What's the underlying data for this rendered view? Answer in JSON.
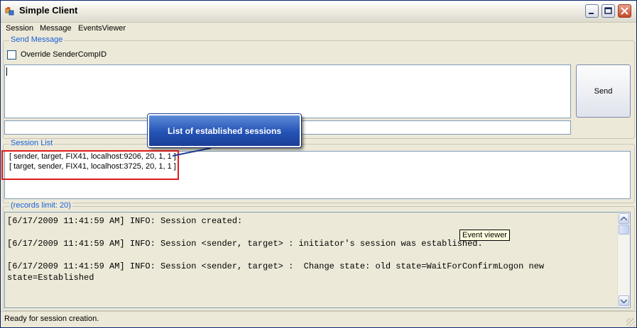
{
  "window": {
    "title": "Simple Client"
  },
  "menu": {
    "items": [
      "Session",
      "Message",
      "EventsViewer"
    ]
  },
  "send_message": {
    "legend": "Send Message",
    "override_label": "Override SenderCompID",
    "override_checked": false,
    "message_value": "",
    "sender_value": "",
    "send_label": "Send"
  },
  "session_list": {
    "legend": "Session List",
    "rows": [
      "[ sender, target, FIX41, localhost:9206, 20, 1, 1 ]",
      "[ target, sender, FIX41, localhost:3725, 20, 1, 1 ]"
    ]
  },
  "annotation": {
    "callout_text": "List of established sessions"
  },
  "events": {
    "legend": "(records limit: 20)",
    "lines": [
      "[6/17/2009 11:41:59 AM] INFO: Session created:",
      "",
      "[6/17/2009 11:41:59 AM] INFO: Session <sender, target> : initiator's session was established.",
      "",
      "[6/17/2009 11:41:59 AM] INFO: Session <sender, target> :  Change state: old state=WaitForConfirmLogon new",
      "state=Established"
    ],
    "tooltip": "Event viewer"
  },
  "status": {
    "text": "Ready for session creation."
  },
  "icons": {
    "app": "app-icon",
    "minimize": "minimize-icon",
    "maximize": "maximize-icon",
    "close": "close-icon",
    "scroll_up": "scroll-up-icon",
    "scroll_down": "scroll-down-icon"
  },
  "colors": {
    "legend_blue": "#1a5fd6",
    "highlight_red": "#e21b1b",
    "callout_blue": "#2453b6"
  }
}
